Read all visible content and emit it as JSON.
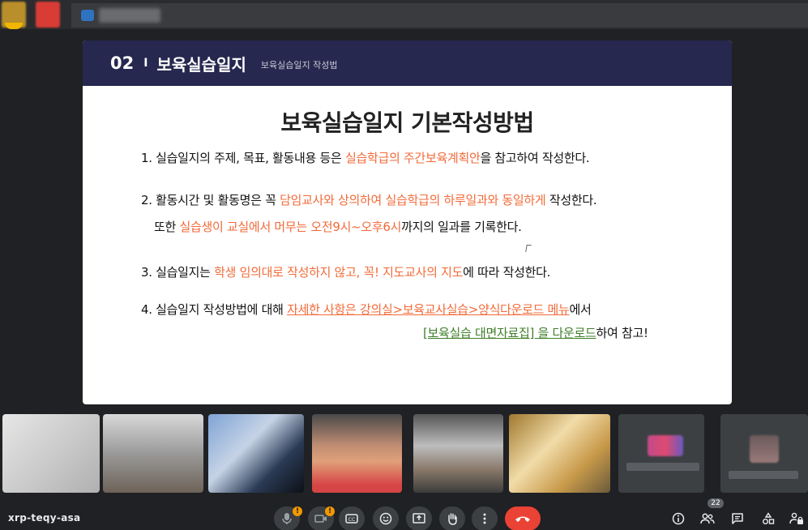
{
  "slide": {
    "header_number": "02",
    "header_separator": "I",
    "header_title": "보육실습일지",
    "header_subtitle": "보육실습일지 작성법",
    "title": "보육실습일지 기본작성방법",
    "items": [
      {
        "line1_a": "1. 실습일지의 주제, 목표, 활동내용 등은 ",
        "line1_hl": "실습학급의 주간보육계획안",
        "line1_b": "을 참고하여 작성한다."
      },
      {
        "line1_a": "2. 활동시간 및 활동명은 꼭 ",
        "line1_hl": "담임교사와 상의하여 실습학급의 하루일과와 동일하게",
        "line1_b": " 작성한다.",
        "line2_a": "또한 ",
        "line2_hl": "실습생이 교실에서 머무는 오전9시~오후6시",
        "line2_b": "까지의 일과를 기록한다."
      },
      {
        "line1_a": "3. 실습일지는 ",
        "line1_hl": "학생 임의대로 작성하지 않고, 꼭! 지도교사의 지도",
        "line1_b": "에 따라 작성한다."
      },
      {
        "line1_a": "4. 실습일지 작성방법에 대해 ",
        "line1_link": "자세한 사항은 강의실>보육교사실습>양식다운로드 메뉴",
        "line1_b": "에서",
        "line2_link": "[보육실습 대면자료집] 을 다운로드",
        "line2_b": "하여 참고!"
      }
    ]
  },
  "meeting": {
    "code": "xrp-teqy-asa",
    "participant_count": "22",
    "mic_badge": "!",
    "cam_badge": "!"
  },
  "icons": {
    "mic": "mic-icon",
    "camera": "camera-icon",
    "captions": "captions-icon",
    "emoji": "emoji-icon",
    "present": "present-icon",
    "raise_hand": "hand-icon",
    "more": "more-vert-icon",
    "end_call": "end-call-icon",
    "info": "info-icon",
    "people": "people-icon",
    "chat": "chat-icon",
    "activities": "activities-icon",
    "host_controls": "lock-person-icon"
  },
  "colors": {
    "background": "#202124",
    "slide_header": "#26284f",
    "highlight": "#f26b3a",
    "link_green": "#3f7f2a",
    "end_call": "#ea4335",
    "warning_badge": "#f29900"
  }
}
